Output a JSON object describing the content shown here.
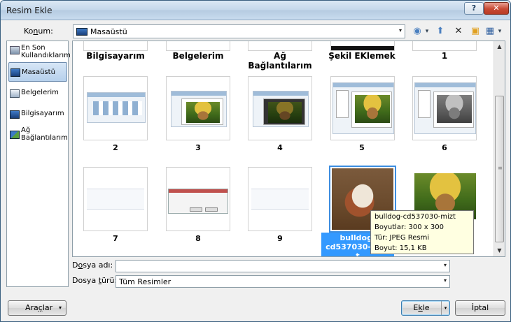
{
  "window": {
    "title": "Resim Ekle",
    "help_glyph": "?",
    "close_glyph": "✕"
  },
  "location": {
    "label_underlined": "n",
    "label_pre": "Ko",
    "label_post": "um:",
    "value": "Masaüstü"
  },
  "toolbar": {
    "back_glyph": "◉",
    "up_glyph": "⬆",
    "delete_glyph": "✕",
    "newfolder_glyph": "▣",
    "views_glyph": "▦",
    "dropdown_glyph": "▾"
  },
  "places": [
    {
      "label": "En Son Kullandıklarım",
      "icon": "recent-icon"
    },
    {
      "label": "Masaüstü",
      "icon": "desktop-icon",
      "selected": true
    },
    {
      "label": "Belgelerim",
      "icon": "documents-icon"
    },
    {
      "label": "Bilgisayarım",
      "icon": "computer-icon"
    },
    {
      "label": "Ağ Bağlantılarım",
      "icon": "network-icon"
    }
  ],
  "files": {
    "top_row": [
      "Bilgisayarım",
      "Belgelerim",
      "Ağ Bağlantılarım",
      "Şekil EKlemek",
      "1"
    ],
    "row1": [
      "2",
      "3",
      "4",
      "5",
      "6"
    ],
    "row2_labels": [
      "7",
      "8",
      "9",
      "bulldog-cd537030-mizt",
      ""
    ],
    "selected_caption_line1": "bulldog-cd537030-mizt",
    "selected_caption_line2": "t"
  },
  "tooltip": {
    "line1": "bulldog-cd537030-mizt",
    "line2": "Boyutlar: 300 x 300",
    "line3": "Tür: JPEG Resmi",
    "line4": "Boyut: 15,1 KB"
  },
  "filename": {
    "label_pre": "D",
    "label_u": "o",
    "label_post": "sya adı:",
    "value": ""
  },
  "filetype": {
    "label_pre": "Dosya ",
    "label_u": "t",
    "label_post": "ürü:",
    "value": "Tüm Resimler"
  },
  "buttons": {
    "tools_pre": "Ara",
    "tools_u": "ç",
    "tools_post": "lar",
    "insert_pre": "E",
    "insert_u": "k",
    "insert_post": "le",
    "cancel": "İptal"
  },
  "colors": {
    "selection": "#3399ff",
    "tooltip_bg": "#ffffe1",
    "close": "#c84a34"
  }
}
